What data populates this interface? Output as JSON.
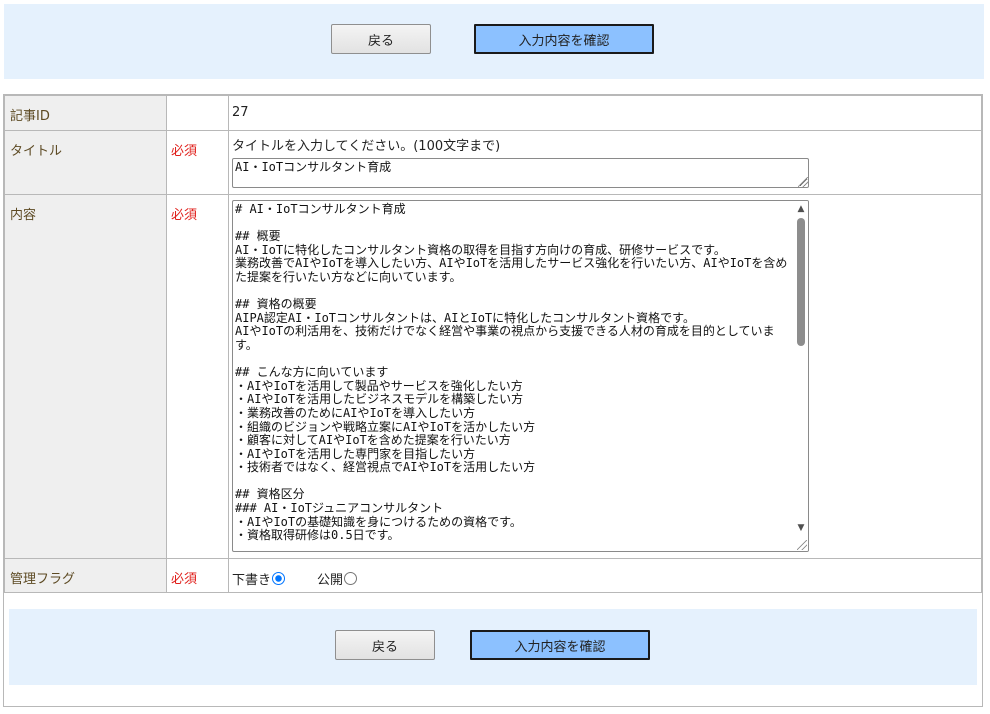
{
  "buttons": {
    "back_label": "戻る",
    "confirm_label": "入力内容を確認"
  },
  "form": {
    "article_id": {
      "label": "記事ID",
      "value": "27"
    },
    "title": {
      "label": "タイトル",
      "required": "必須",
      "hint": "タイトルを入力してください。(100文字まで)",
      "value": "AI・IoTコンサルタント育成"
    },
    "content": {
      "label": "内容",
      "required": "必須",
      "value": "# AI・IoTコンサルタント育成\n\n## 概要\nAI・IoTに特化したコンサルタント資格の取得を目指す方向けの育成、研修サービスです。\n業務改善でAIやIoTを導入したい方、AIやIoTを活用したサービス強化を行いたい方、AIやIoTを含めた提案を行いたい方などに向いています。\n\n## 資格の概要\nAIPA認定AI・IoTコンサルタントは、AIとIoTに特化したコンサルタント資格です。\nAIやIoTの利活用を、技術だけでなく経営や事業の視点から支援できる人材の育成を目的としています。\n\n## こんな方に向いています\n・AIやIoTを活用して製品やサービスを強化したい方\n・AIやIoTを活用したビジネスモデルを構築したい方\n・業務改善のためにAIやIoTを導入したい方\n・組織のビジョンや戦略立案にAIやIoTを活かしたい方\n・顧客に対してAIやIoTを含めた提案を行いたい方\n・AIやIoTを活用した専門家を目指したい方\n・技術者ではなく、経営視点でAIやIoTを活用したい方\n\n## 資格区分\n### AI・IoTジュニアコンサルタント\n・AIやIoTの基礎知識を身につけるための資格です。\n・資格取得研修は0.5日です。"
    },
    "flag": {
      "label": "管理フラグ",
      "required": "必須",
      "options": [
        {
          "label": "下書き",
          "selected": true
        },
        {
          "label": "公開",
          "selected": false
        }
      ]
    }
  }
}
